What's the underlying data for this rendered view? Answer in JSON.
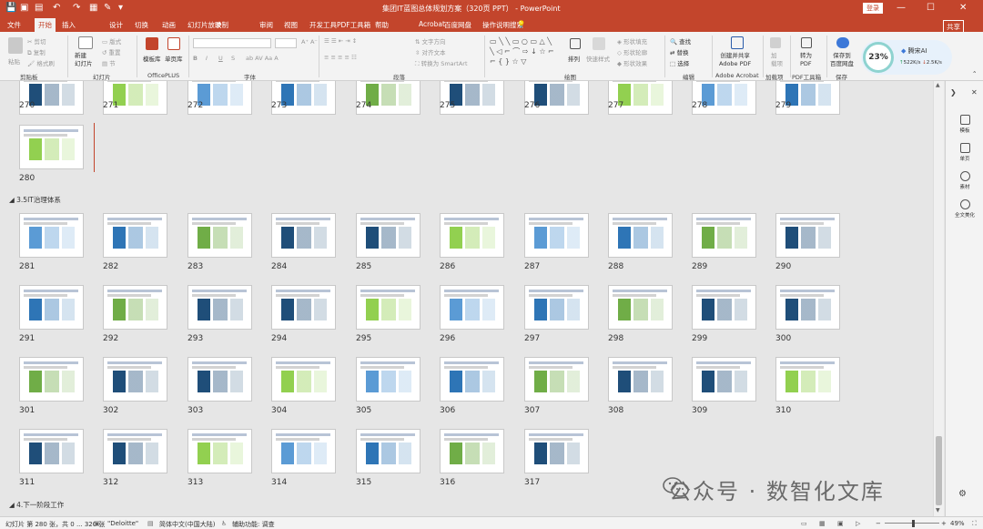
{
  "titlebar": {
    "title": "集团IT蓝图总体规划方案（320页 PPT） - PowerPoint",
    "login": "登录",
    "win_min": "—",
    "win_max": "☐",
    "win_close": "✕"
  },
  "tabs": [
    "文件",
    "开始",
    "插入",
    "设计",
    "切换",
    "动画",
    "幻灯片放映",
    "录制",
    "审阅",
    "视图",
    "开发工具",
    "PDF工具箱",
    "帮助",
    "Acrobat",
    "百度网盘",
    "操作说明搜索"
  ],
  "share": "共享",
  "ribbon": {
    "paste": "粘贴",
    "cut": "剪切",
    "copy": "复制",
    "format_painter": "格式刷",
    "clipboard": "剪贴板",
    "new_slide": "新建\n幻灯片",
    "layout": "版式",
    "reset": "重置",
    "section": "节",
    "slides_group": "幻灯片",
    "template": "模板库",
    "single_page": "单页库",
    "officeplus": "OfficePLUS",
    "font_group": "字体",
    "font_b": "B",
    "font_i": "I",
    "font_u": "U",
    "font_s": "S",
    "text_direction": "文字方向",
    "align_text": "对齐文本",
    "smartart": "转换为 SmartArt",
    "paragraph": "段落",
    "arrange": "排列",
    "quick_styles": "快速样式",
    "shape_fill": "形状填充",
    "shape_outline": "形状轮廓",
    "shape_effects": "形状效果",
    "drawing": "绘图",
    "find": "查找",
    "replace": "替换",
    "select": "选择",
    "editing": "编辑",
    "create_share": "创建并共享\nAdobe PDF",
    "adobe_acrobat": "Adobe Acrobat",
    "addin": "加\n载项",
    "addin_group": "加载项",
    "to_pdf": "转为\nPDF",
    "pdf_group": "PDF工具箱",
    "save_baidu": "保存到\n百度网盘",
    "save_group": "保存",
    "ai_label": "腾宋AI",
    "ai_percent": "23%",
    "ai_up": "522K/s",
    "ai_down": "2.5K/s"
  },
  "sections": {
    "s1": "3.5IT治理体系",
    "s2": "4.下一阶段工作"
  },
  "slide_numbers": {
    "row0": [
      "270",
      "271",
      "272",
      "273",
      "274",
      "275",
      "276",
      "277",
      "278",
      "279"
    ],
    "row1": [
      "280"
    ],
    "row2": [
      "281",
      "282",
      "283",
      "284",
      "285",
      "286",
      "287",
      "288",
      "289",
      "290"
    ],
    "row3": [
      "291",
      "292",
      "293",
      "294",
      "295",
      "296",
      "297",
      "298",
      "299",
      "300"
    ],
    "row4": [
      "301",
      "302",
      "303",
      "304",
      "305",
      "306",
      "307",
      "308",
      "309",
      "310"
    ],
    "row5": [
      "311",
      "312",
      "313",
      "314",
      "315",
      "316",
      "317"
    ]
  },
  "right_panel": [
    "模板",
    "单页",
    "素材",
    "全文美化"
  ],
  "status": {
    "slide_info": "幻灯片 第 280 张，共 0 ... 320 张",
    "theme": "\"Deloitte\"",
    "lang": "简体中文(中国大陆)",
    "accessibility": "辅助功能: 调查",
    "zoom": "49%"
  },
  "watermark": "公众号 · 数智化文库",
  "colors": {
    "brand": "#c3452c",
    "selection": "#c3452c",
    "slide_blue": "#1f4e79",
    "slide_green": "#92d050"
  }
}
